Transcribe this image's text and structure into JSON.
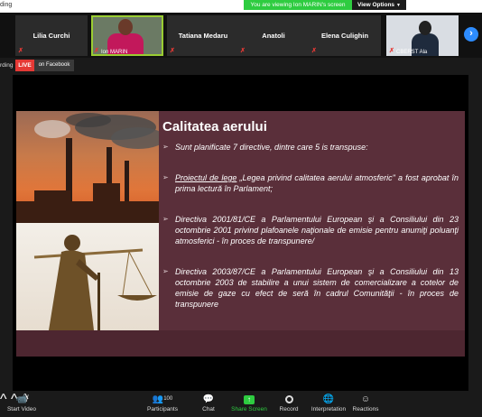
{
  "topbar": {
    "recording_text": "ding",
    "viewing_banner": "You are viewing Ion MARIN's screen",
    "view_options": "View Options"
  },
  "participants": [
    {
      "name": "Lilia Curchi",
      "video": false,
      "active": false
    },
    {
      "name": "Ion MARIN",
      "video": true,
      "active": true
    },
    {
      "name": "Tatiana Medaru",
      "video": false,
      "active": false
    },
    {
      "name": "Anatoli",
      "video": false,
      "active": false
    },
    {
      "name": "Elena Culighin",
      "video": false,
      "active": false
    },
    {
      "name": "CBERST Ala",
      "video": true,
      "active": false
    }
  ],
  "live": {
    "recording_label": "rding",
    "live_badge": "LIVE",
    "platform": "on Facebook"
  },
  "slide": {
    "title": "Calitatea aerului",
    "bullets": [
      {
        "text": "Sunt planificate  7 directive, dintre care 5 is transpuse:"
      },
      {
        "underlined": "Proiectul de lege",
        "text": " „Legea privind calitatea aerului atmosferic\" a fost aprobat în prima lectură în Parlament;"
      },
      {
        "text": "Directiva 2001/81/CE a Parlamentului European şi a Consiliului din 23 octombrie 2001 privind plafoanele naţionale de emisie pentru anumiţi poluanţi atmosferici   - în proces de transpunere/"
      },
      {
        "text": "Directiva 2003/87/CE a Parlamentului European şi a Consiliului din 13 octombrie 2003 de stabilire a unui sistem de comercializare a cotelor de emisie de gaze cu efect de seră în cadrul Comunităţii   - în proces de transpunere"
      }
    ]
  },
  "toolbar": {
    "start_video": "Start Video",
    "participants": "Participants",
    "participants_count": "100",
    "chat": "Chat",
    "share_screen": "Share Screen",
    "record": "Record",
    "interpretation": "Interpretation",
    "reactions": "Reactions"
  },
  "colors": {
    "slide_bg": "#5a2f3a",
    "share_green": "#2ecc40",
    "live_red": "#e53935",
    "nav_blue": "#2d8cff"
  }
}
